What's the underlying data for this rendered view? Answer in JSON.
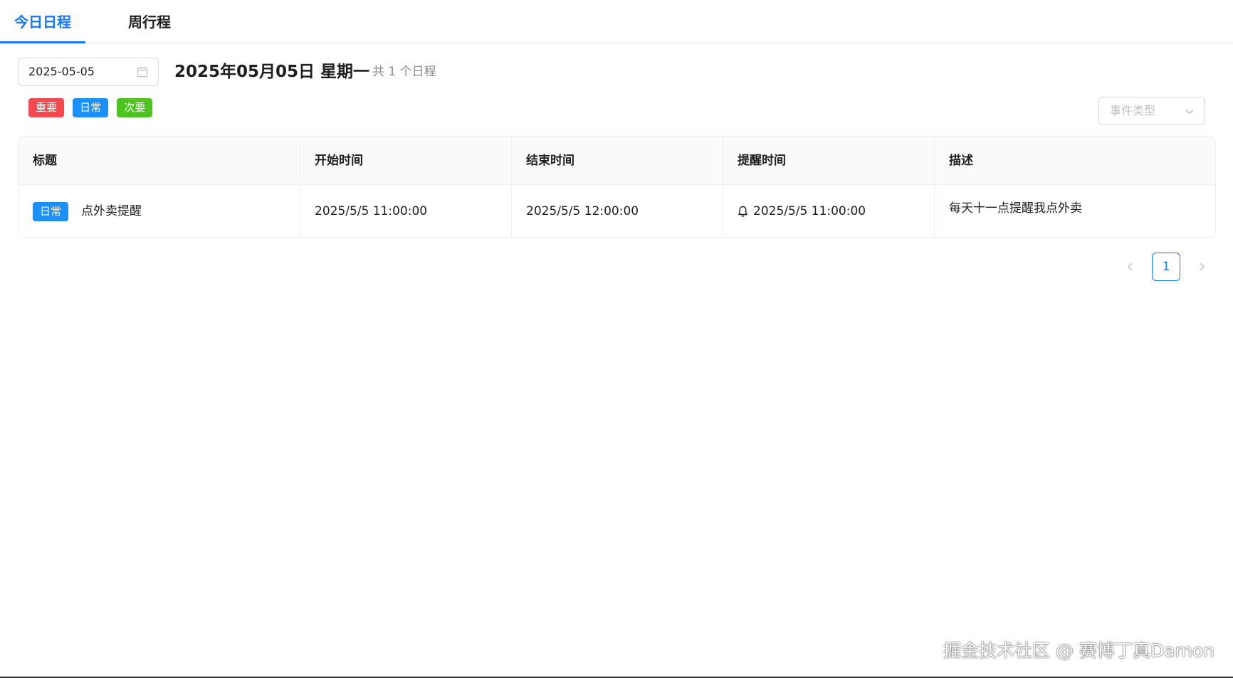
{
  "tabs": [
    {
      "label": "今日日程",
      "active": true
    },
    {
      "label": "周行程",
      "active": false
    }
  ],
  "toolbar": {
    "date_value": "2025-05-05",
    "date_heading": "2025年05月05日 星期一",
    "count_text": "共 1 个日程"
  },
  "legend": [
    {
      "label": "重要",
      "color": "#f5484f"
    },
    {
      "label": "日常",
      "color": "#1b8ffa"
    },
    {
      "label": "次要",
      "color": "#4cc520"
    }
  ],
  "event_type_select": {
    "placeholder": "事件类型"
  },
  "table": {
    "columns": [
      "标题",
      "开始时间",
      "结束时间",
      "提醒时间",
      "描述"
    ],
    "rows": [
      {
        "tag": "日常",
        "tag_color": "#1b8ffa",
        "title": "点外卖提醒",
        "start": "2025/5/5 11:00:00",
        "end": "2025/5/5 12:00:00",
        "remind": "2025/5/5 11:00:00",
        "description": "每天十一点提醒我点外卖"
      }
    ]
  },
  "pagination": {
    "current_page": "1"
  },
  "watermark": "掘金技术社区 @ 赛博丁真Damon",
  "colors": {
    "primary": "#1677ff",
    "important": "#f5484f",
    "daily": "#1b8ffa",
    "minor": "#4cc520"
  }
}
